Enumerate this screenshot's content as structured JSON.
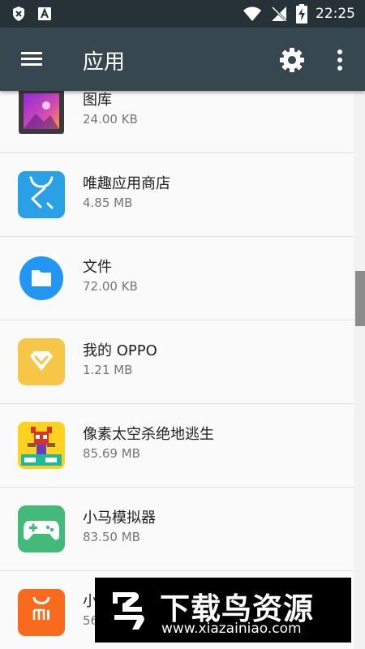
{
  "status_bar": {
    "time": "22:25",
    "icons": [
      "vpn-key-icon",
      "keyboard-a-icon",
      "wifi-icon",
      "no-signal-icon",
      "battery-charging-icon"
    ]
  },
  "app_bar": {
    "title": "应用",
    "icons": [
      "menu-icon",
      "gear-icon",
      "more-vert-icon"
    ]
  },
  "apps": [
    {
      "name": "图库",
      "size": "24.00 KB",
      "icon": "gallery-icon"
    },
    {
      "name": "唯趣应用商店",
      "size": "4.85 MB",
      "icon": "store-icon"
    },
    {
      "name": "文件",
      "size": "72.00 KB",
      "icon": "folder-icon"
    },
    {
      "name": "我的 OPPO",
      "size": "1.21 MB",
      "icon": "diamond-icon"
    },
    {
      "name": "像素太空杀绝地逃生",
      "size": "85.69 MB",
      "icon": "pixel-game-icon"
    },
    {
      "name": "小马模拟器",
      "size": "83.50 MB",
      "icon": "gamepad-icon"
    },
    {
      "name": "小",
      "size": "56",
      "icon": "mi-store-icon"
    }
  ],
  "colors": {
    "status_bar": "#263238",
    "app_bar": "#37474f",
    "background": "#fafafa"
  },
  "watermark": {
    "title": "下载鸟资源",
    "url": "www.xiazainiao.com"
  }
}
